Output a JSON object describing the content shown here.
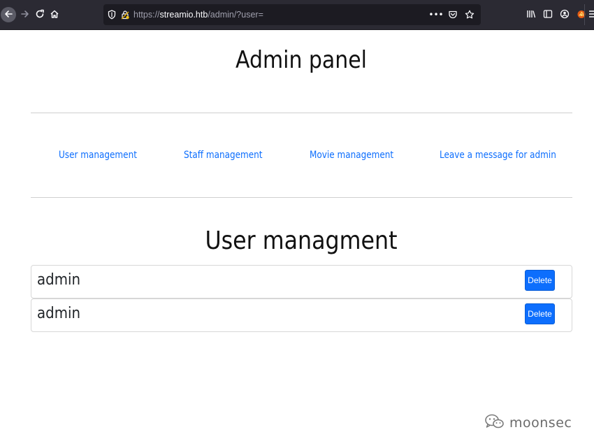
{
  "browser": {
    "url_scheme": "https://",
    "url_host": "streamio.htb",
    "url_path": "/admin/?user=",
    "page_actions_icon": "•••",
    "icons": [
      "back-icon",
      "forward-icon",
      "reload-icon",
      "home-icon",
      "shield-icon",
      "lock-icon",
      "pocket-icon",
      "bookmark-star-icon",
      "library-icon",
      "sidebar-icon",
      "account-icon",
      "extension-icon",
      "hamburger-menu-icon"
    ]
  },
  "page": {
    "title": "Admin panel",
    "nav_links": [
      {
        "label": "User management"
      },
      {
        "label": "Staff management"
      },
      {
        "label": "Movie management"
      },
      {
        "label": "Leave a message for admin"
      }
    ],
    "section_title": "User managment",
    "users": [
      {
        "name": "admin",
        "action": "Delete"
      },
      {
        "name": "admin",
        "action": "Delete"
      }
    ]
  },
  "watermark": {
    "text": "moonsec"
  },
  "colors": {
    "link": "#0d6efd",
    "button": "#0d6efd",
    "toolbar": "#2b2a33",
    "urlbar": "#1c1b22"
  }
}
